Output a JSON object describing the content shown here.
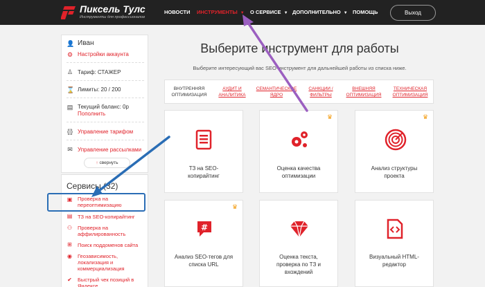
{
  "header": {
    "logo_title": "Пиксель Тулс",
    "logo_sub": "Инструменты для профессионалов",
    "nav": [
      {
        "label": "НОВОСТИ",
        "dropdown": false,
        "active": false
      },
      {
        "label": "ИНСТРУМЕНТЫ",
        "dropdown": true,
        "active": true
      },
      {
        "label": "О СЕРВИСЕ",
        "dropdown": true,
        "active": false
      },
      {
        "label": "ДОПОЛНИТЕЛЬНО",
        "dropdown": true,
        "active": false
      },
      {
        "label": "ПОМОЩЬ",
        "dropdown": false,
        "active": false
      }
    ],
    "exit_label": "Выход"
  },
  "sidebar": {
    "user_name": "Иван",
    "account_settings": "Настройки аккаунта",
    "tariff": "Тариф: СТАЖЕР",
    "limits": "Лимиты: 20 / 200",
    "balance": "Текущий баланс: 0р",
    "topup": "Пополнить",
    "manage_tariff": "Управление тарифом",
    "manage_mailings": "Управление рассылками",
    "collapse": "свернуть",
    "services_title": "Сервисы (32)",
    "services": [
      "Проверка на переоптимизацию",
      "ТЗ на SEO-копирайтинг",
      "Проверка на аффилированность",
      "Поиск поддоменов сайта",
      "Геозависимость, локализация и коммерциализация",
      "Быстрый чек позиций в Яндексе"
    ]
  },
  "main": {
    "title": "Выберите инструмент для работы",
    "subtitle": "Выберите интересующий вас SEO-инструмент для дальнейшей работы из списка ниже.",
    "tabs": [
      "ВНУТРЕННЯЯ ОПТИМИЗАЦИЯ",
      "АУДИТ И АНАЛИТИКА",
      "СЕМАНТИЧЕСКОЕ ЯДРО",
      "САНКЦИИ / ФИЛЬТРЫ",
      "ВНЕШНЯЯ ОПТИМИЗАЦИЯ",
      "ТЕХНИЧЕСКАЯ ОПТИМИЗАЦИЯ"
    ],
    "tools": [
      {
        "label": "ТЗ на SEO-копирайтинг",
        "icon": "document-icon",
        "premium": false
      },
      {
        "label": "Оценка качества оптимизации",
        "icon": "gears-icon",
        "premium": true
      },
      {
        "label": "Анализ структуры проекта",
        "icon": "spiral-icon",
        "premium": true
      },
      {
        "label": "Анализ SEO-тегов для списка URL",
        "icon": "hashtag-icon",
        "premium": true
      },
      {
        "label": "Оценка текста, проверка по ТЗ и вхождений",
        "icon": "diamond-icon",
        "premium": false
      },
      {
        "label": "Визуальный HTML-редактор",
        "icon": "code-file-icon",
        "premium": false
      }
    ]
  },
  "colors": {
    "accent": "#e0222a",
    "nav_bg": "#222222",
    "annotation_blue": "#2a6db5",
    "annotation_purple": "#9b5fc0"
  }
}
